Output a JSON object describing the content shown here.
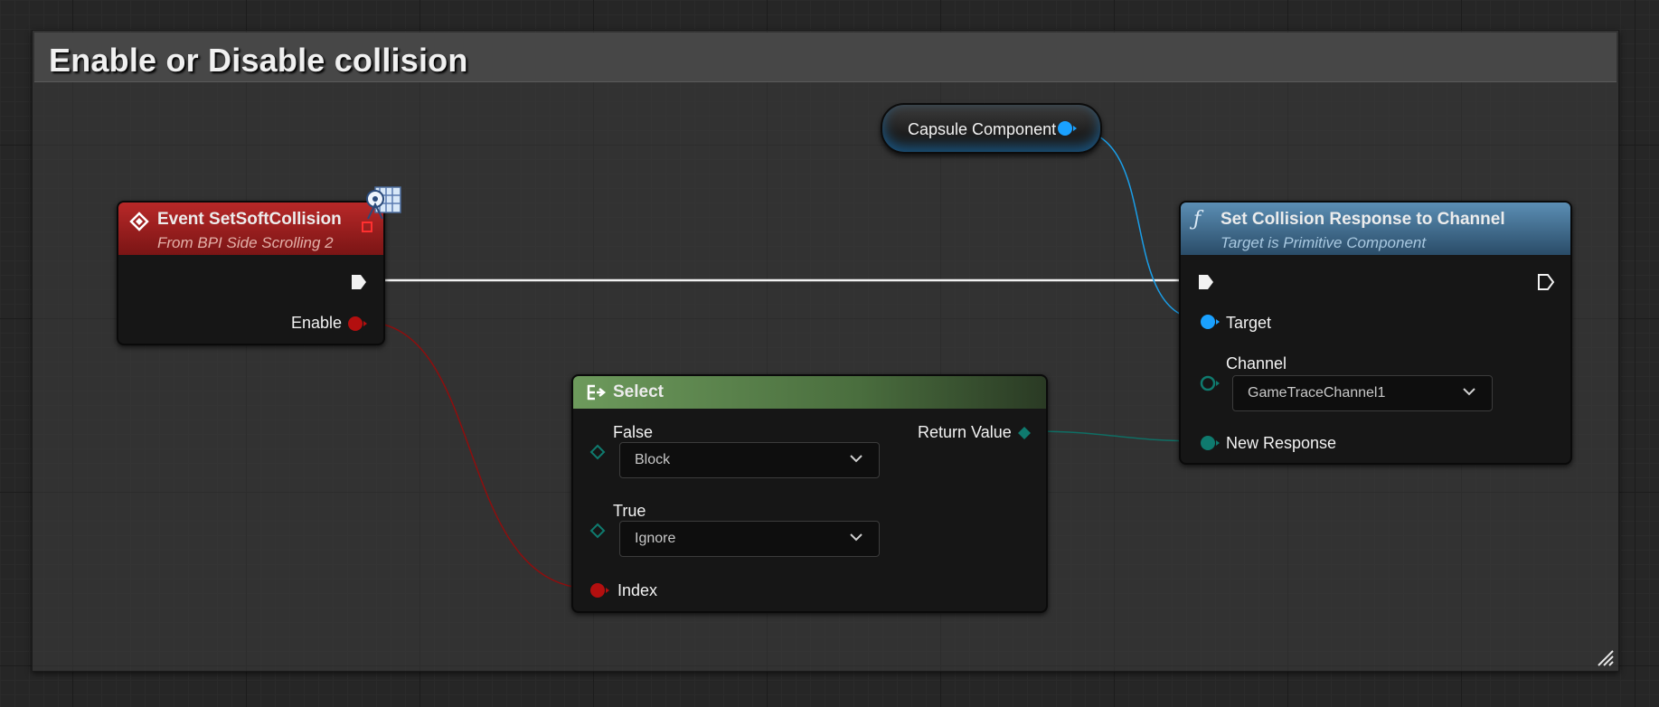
{
  "comment": {
    "title": "Enable or Disable collision"
  },
  "event_node": {
    "title": "Event SetSoftCollision",
    "subtitle": "From BPI Side Scrolling 2",
    "pins": {
      "enable": "Enable"
    },
    "icons": {
      "header": "event-diamond-icon",
      "badge": "interface-message-icon"
    },
    "colors": {
      "header": "#8e1d1d",
      "subtitle": "#e3b0a8",
      "bool_pin": "#b30f0f"
    }
  },
  "capsule_node": {
    "label": "Capsule Component",
    "colors": {
      "pin": "#1aa1ff"
    }
  },
  "set_collision_node": {
    "title": "Set Collision Response to Channel",
    "subtitle": "Target is Primitive Component",
    "pins": {
      "target": "Target",
      "channel": "Channel",
      "channel_value": "GameTraceChannel1",
      "new_response": "New Response"
    },
    "icons": {
      "header": "function-icon"
    },
    "colors": {
      "header": "#3d6a8e",
      "subtitle": "#a8c8e0",
      "enum_pin": "#0f7a6e"
    }
  },
  "select_node": {
    "title": "Select",
    "pins": {
      "false_label": "False",
      "false_value": "Block",
      "true_label": "True",
      "true_value": "Ignore",
      "index": "Index",
      "return_value": "Return Value"
    },
    "icons": {
      "header": "select-icon"
    },
    "colors": {
      "header": "#4e7043",
      "wildcard_pin": "#0f7a6e"
    }
  }
}
